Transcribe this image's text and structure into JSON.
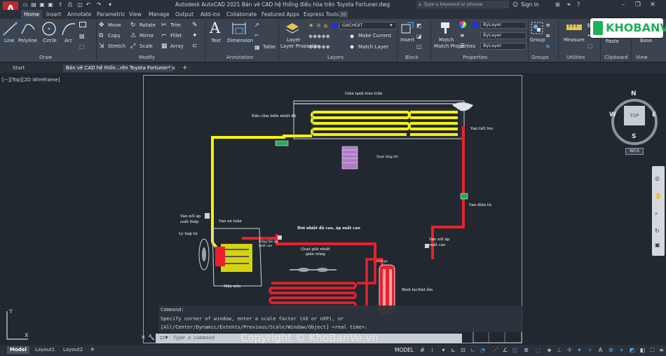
{
  "app": {
    "logo_letter": "A",
    "title": "Autodesk AutoCAD 2021    Bản vẽ CAD  hệ thống điều hòa trên Toyota Fortuner.dwg",
    "search_placeholder": "Type a keyword or phrase",
    "sign_in": "Sign In"
  },
  "ribbon_tabs": [
    "Home",
    "Insert",
    "Annotate",
    "Parametric",
    "View",
    "Manage",
    "Output",
    "Add-ins",
    "Collaborate",
    "Featured Apps",
    "Express Tools"
  ],
  "ribbon": {
    "draw": {
      "title": "Draw",
      "line": "Line",
      "polyline": "Polyline",
      "circle": "Circle",
      "arc": "Arc"
    },
    "modify": {
      "title": "Modify",
      "move": "Move",
      "rotate": "Rotate",
      "trim": "Trim",
      "copy": "Copy",
      "mirror": "Mirror",
      "fillet": "Fillet",
      "stretch": "Stretch",
      "scale": "Scale",
      "array": "Array"
    },
    "annotation": {
      "title": "Annotation",
      "text": "Text",
      "dimension": "Dimension",
      "table": "Table"
    },
    "layers": {
      "title": "Layers",
      "layer_properties": "Layer Properties",
      "current_layer": "GACHDIT",
      "make_current": "Make Current",
      "match_layer": "Match Layer"
    },
    "block": {
      "title": "Block",
      "insert": "Insert"
    },
    "properties": {
      "title": "Properties",
      "match_properties": "Match Properties",
      "color": "ByLayer",
      "linetype": "ByLayer",
      "lineweight": "ByLayer"
    },
    "groups": {
      "title": "Groups",
      "group": "Group"
    },
    "utilities": {
      "title": "Utilities",
      "measure": "Measure"
    },
    "clipboard": {
      "title": "Clipboard",
      "paste": "Paste"
    },
    "view": {
      "title": "View",
      "base": "Base"
    }
  },
  "doc_tabs": [
    "Start",
    "Bản vẽ CAD  hệ thốn...rên Toyota Fortuner*"
  ],
  "viewport": {
    "label": "[−][Top][2D Wireframe]",
    "viewcube": {
      "top": "TOP",
      "n": "N",
      "s": "S",
      "e": "E",
      "w": "W",
      "wcs": "WCS"
    }
  },
  "drawing_labels": {
    "evaporator_title": "Giàn lạnh treo trần",
    "temp_sensor": "Đầu cảm biến nhiệt độ",
    "expansion_valve": "Van tiết lưu",
    "blower": "Quạt tăng tốc",
    "solenoid_valve": "Van điện từ",
    "low_pressure_valve": "Van nối áp suất thấp",
    "safety_valve": "Van an toàn",
    "clutch": "Ly hợp từ",
    "compressor": "Máy nén",
    "high_pressure_gas": "Hơi nhiệt độ cao, áp suất cao",
    "pressure_switch": "Công tắc áp suất cao",
    "condenser_fan": "Quạt giải nhiệt giàn nóng",
    "high_pressure_valve": "Van nối áp suất cao",
    "receiver_dryer": "Bình lọc/hút ẩm",
    "filter_mark": "mắt ga"
  },
  "watermark": "Copyright © KhoBanVe.vn",
  "brand": "KHOBANVE",
  "command": {
    "lines": [
      "Command:",
      "Specify corner of window, enter a scale factor (nX or nXP), or",
      "[All/Center/Dynamic/Extents/Previous/Scale/Window/Object] <real time>:"
    ],
    "placeholder": "Type a command"
  },
  "status": {
    "model_tab": "Model",
    "layouts": [
      "Layout1",
      "Layout2"
    ],
    "space": "MODEL"
  },
  "colors": {
    "accent": "#1f8ad8",
    "pipe_hot": "#e8212d",
    "pipe_cold": "#f5f20a",
    "logo_red": "#c1272d"
  }
}
